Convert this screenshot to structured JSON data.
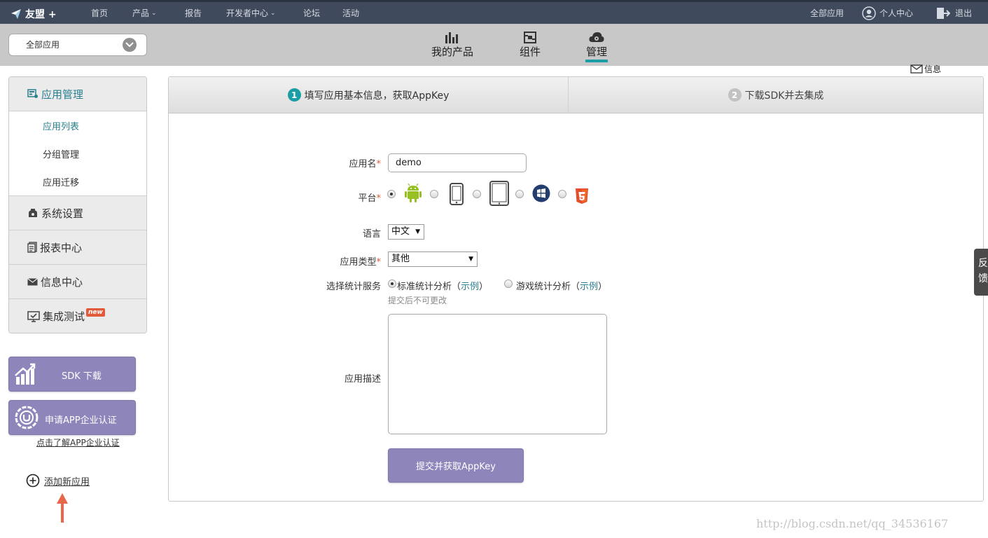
{
  "topbar": {
    "brand": "友盟 +",
    "nav": [
      {
        "label": "首页",
        "dropdown": false
      },
      {
        "label": "产品",
        "dropdown": true
      },
      {
        "label": "报告",
        "dropdown": false
      },
      {
        "label": "开发者中心",
        "dropdown": true
      },
      {
        "label": "论坛",
        "dropdown": false
      },
      {
        "label": "活动",
        "dropdown": false
      }
    ],
    "all_apps": "全部应用",
    "profile": "个人中心",
    "logout": "退出"
  },
  "subbar": {
    "app_select_value": "全部应用",
    "tabs": [
      {
        "label": "我的产品",
        "icon": "bar-chart-icon",
        "active": false
      },
      {
        "label": "组件",
        "icon": "component-icon",
        "active": false
      },
      {
        "label": "管理",
        "icon": "cloud-gear-icon",
        "active": true
      }
    ],
    "message": "信息"
  },
  "sidebar": {
    "groups": [
      {
        "label": "应用管理",
        "icon": "app-manage-icon",
        "active": true,
        "items": [
          {
            "label": "应用列表",
            "active": true
          },
          {
            "label": "分组管理",
            "active": false
          },
          {
            "label": "应用迁移",
            "active": false
          }
        ]
      },
      {
        "label": "系统设置",
        "icon": "settings-icon",
        "active": false
      },
      {
        "label": "报表中心",
        "icon": "report-icon",
        "active": false
      },
      {
        "label": "信息中心",
        "icon": "mail-icon",
        "active": false
      },
      {
        "label": "集成测试",
        "icon": "monitor-check-icon",
        "active": false,
        "badge": "new"
      }
    ],
    "sdk_button": "SDK 下载",
    "cert_button": "申请APP企业认证",
    "cert_link": "点击了解APP企业认证",
    "add_app": "添加新应用"
  },
  "steps": [
    {
      "num": "1",
      "label": "填写应用基本信息，获取AppKey",
      "active": true
    },
    {
      "num": "2",
      "label": "下载SDK并去集成",
      "active": false
    }
  ],
  "form": {
    "app_name_label": "应用名",
    "app_name_value": "demo",
    "platform_label": "平台",
    "platforms": [
      {
        "name": "android-icon",
        "selected": true
      },
      {
        "name": "iphone-icon",
        "selected": false
      },
      {
        "name": "ipad-icon",
        "selected": false
      },
      {
        "name": "windows-phone-icon",
        "selected": false
      },
      {
        "name": "html5-icon",
        "selected": false
      }
    ],
    "language_label": "语言",
    "language_value": "中文",
    "type_label": "应用类型",
    "type_value": "其他",
    "service_label": "选择统计服务",
    "service_options": [
      {
        "label": "标准统计分析",
        "example": "示例",
        "selected": true
      },
      {
        "label": "游戏统计分析",
        "example": "示例",
        "selected": false
      }
    ],
    "service_note": "提交后不可更改",
    "desc_label": "应用描述",
    "desc_value": "",
    "required_mark": "*",
    "submit": "提交并获取AppKey"
  },
  "feedback": "反馈",
  "watermark": "http://blog.csdn.net/qq_34536167",
  "colors": {
    "topbar_bg": "#3f4a5c",
    "accent_teal": "#1a9ea6",
    "button_purple": "#8e86bb",
    "required_red": "#e35a3a"
  }
}
